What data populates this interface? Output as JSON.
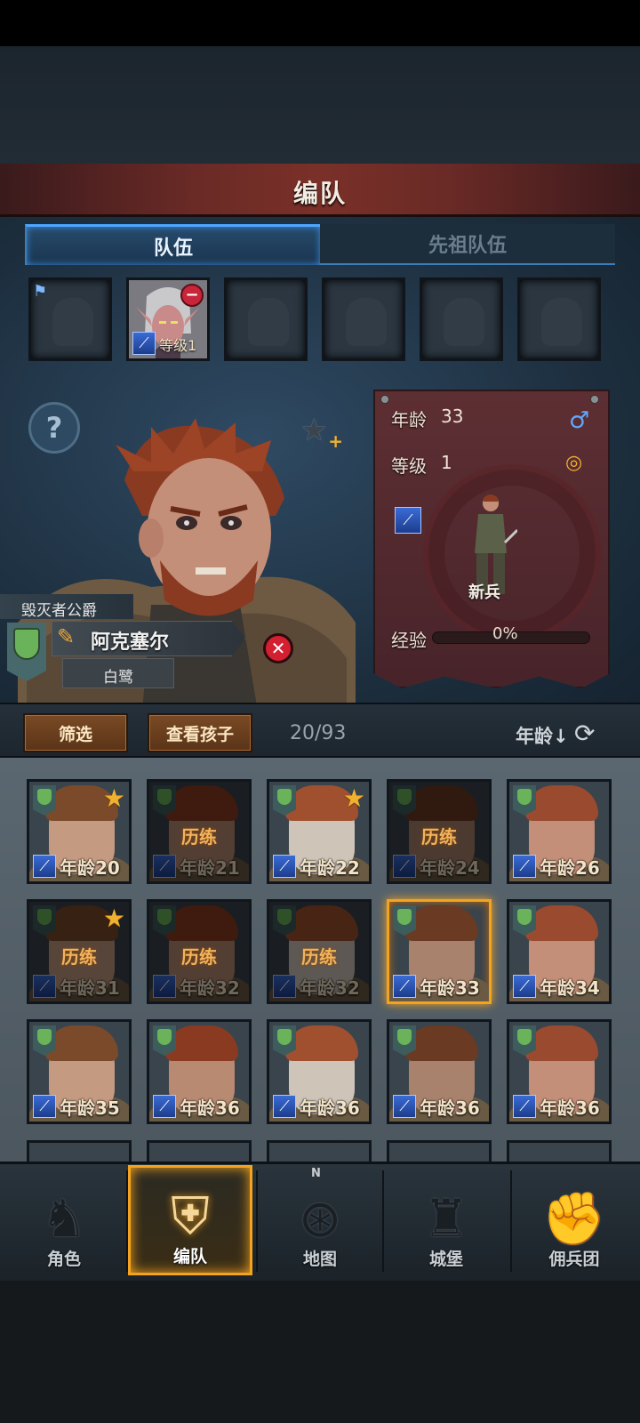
{
  "header": {
    "title": "编队"
  },
  "tabs": [
    {
      "label": "队伍",
      "active": true
    },
    {
      "label": "先祖队伍",
      "active": false
    }
  ],
  "team_slots": {
    "slot2_level": "等级1"
  },
  "hero": {
    "title": "毁灭者公爵",
    "name": "阿克塞尔",
    "subtitle": "白鹭",
    "stats": {
      "age_label": "年龄",
      "age_value": "33",
      "level_label": "等级",
      "level_value": "1",
      "class_name": "新兵",
      "xp_label": "经验",
      "xp_value": "0%"
    }
  },
  "toolbar": {
    "filter_label": "筛选",
    "children_label": "查看孩子",
    "count": "20/93",
    "sort_label": "年龄↓"
  },
  "roster": [
    {
      "age": "年龄20",
      "star": true,
      "training": false,
      "dim": false
    },
    {
      "age": "年龄21",
      "star": false,
      "training": true,
      "dim": true
    },
    {
      "age": "年龄22",
      "star": true,
      "training": false,
      "dim": false
    },
    {
      "age": "年龄24",
      "star": false,
      "training": true,
      "dim": true
    },
    {
      "age": "年龄26",
      "star": false,
      "training": false,
      "dim": false
    },
    {
      "age": "年龄31",
      "star": true,
      "training": true,
      "dim": true
    },
    {
      "age": "年龄32",
      "star": false,
      "training": true,
      "dim": true
    },
    {
      "age": "年龄32",
      "star": false,
      "training": true,
      "dim": true
    },
    {
      "age": "年龄33",
      "star": false,
      "training": false,
      "dim": false,
      "selected": true
    },
    {
      "age": "年龄34",
      "star": false,
      "training": false,
      "dim": false
    },
    {
      "age": "年龄35",
      "star": false,
      "training": false,
      "dim": false
    },
    {
      "age": "年龄36",
      "star": false,
      "training": false,
      "dim": false
    },
    {
      "age": "年龄36",
      "star": false,
      "training": false,
      "dim": false
    },
    {
      "age": "年龄36",
      "star": false,
      "training": false,
      "dim": false
    },
    {
      "age": "年龄36",
      "star": false,
      "training": false,
      "dim": false
    }
  ],
  "training_label": "历练",
  "nav": [
    {
      "label": "角色",
      "icon": "knight-icon"
    },
    {
      "label": "编队",
      "icon": "helmet-icon",
      "active": true
    },
    {
      "label": "地图",
      "icon": "compass-map-icon"
    },
    {
      "label": "城堡",
      "icon": "castle-icon"
    },
    {
      "label": "佣兵团",
      "icon": "mercenary-fist-icon"
    }
  ],
  "compass_n": "N",
  "colors": {
    "accent": "#f4a31f",
    "tab_active": "#4da6ff",
    "card": "#5d2f33",
    "remove": "#c8243a"
  }
}
